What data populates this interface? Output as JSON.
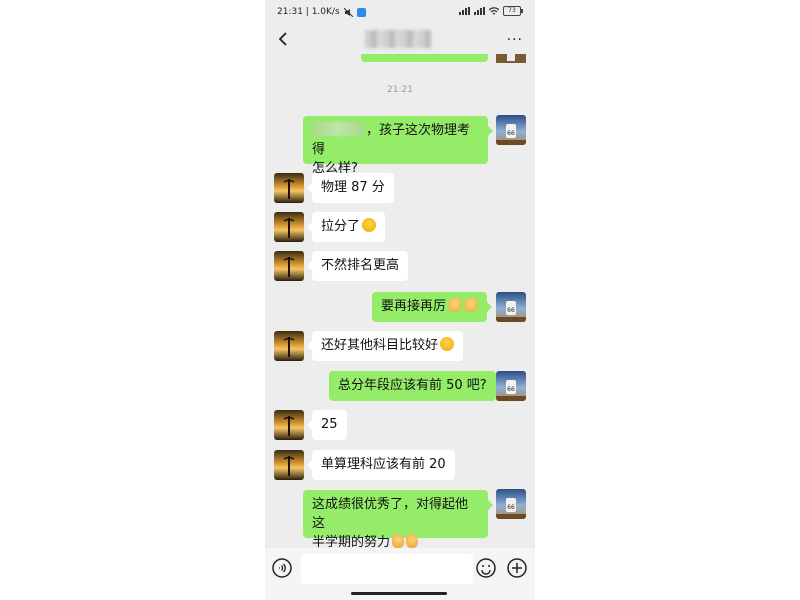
{
  "status_bar": {
    "time_speed": "21:31 | 1.0K/s",
    "battery": "73"
  },
  "header": {
    "more": "···"
  },
  "timestamp": "21:21",
  "messages": [
    {
      "side": "out",
      "text": "，孩子这次物理考得",
      "text2": "怎么样?"
    },
    {
      "side": "in",
      "text": "物理 87 分"
    },
    {
      "side": "in",
      "text": "拉分了"
    },
    {
      "side": "in",
      "text": "不然排名更高"
    },
    {
      "side": "out",
      "text": "要再接再厉"
    },
    {
      "side": "in",
      "text": "还好其他科目比较好"
    },
    {
      "side": "out",
      "text": "总分年段应该有前 50 吧?"
    },
    {
      "side": "in",
      "text": "25"
    },
    {
      "side": "in",
      "text": "单算理科应该有前 20"
    },
    {
      "side": "out",
      "text": "这成绩很优秀了，对得起他这",
      "text2": "半学期的努力"
    }
  ],
  "colors": {
    "chat_bg": "#ededed",
    "out_bubble": "#95ec69",
    "in_bubble": "#ffffff"
  },
  "icons": {
    "back": "chevron-left-icon",
    "voice": "voice-icon",
    "emoji": "emoji-icon",
    "plus": "plus-icon"
  }
}
